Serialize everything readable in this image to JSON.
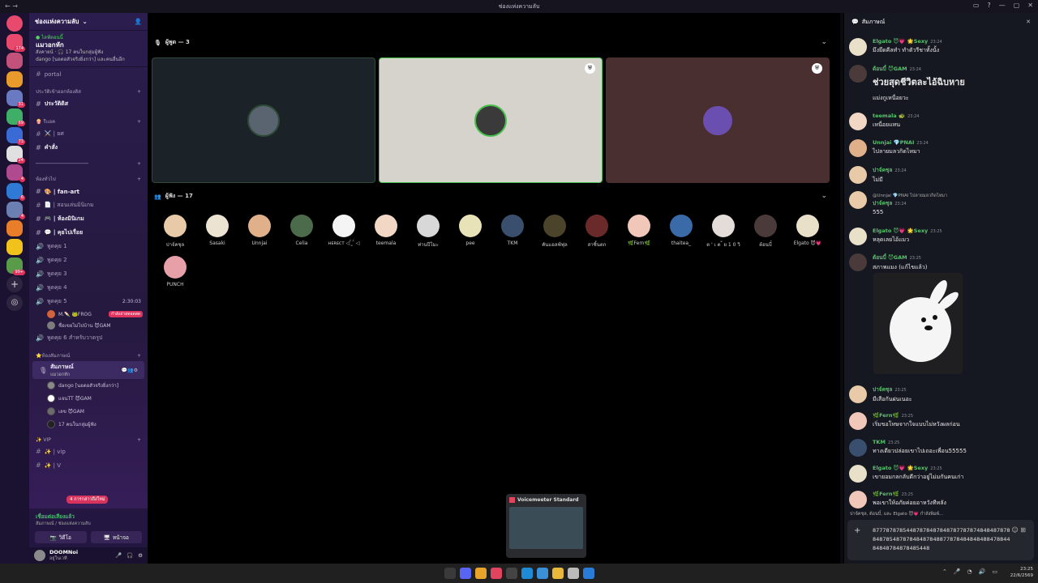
{
  "window": {
    "title": "ช่องแห่งความลับ"
  },
  "servers": [
    {
      "color": "#e84a6e",
      "badge": "174"
    },
    {
      "color": "#c2527a",
      "badge": ""
    },
    {
      "color": "#e89b2a",
      "badge": ""
    },
    {
      "color": "#6a7ac2",
      "badge": "31"
    },
    {
      "color": "#3fae67",
      "badge": "69"
    },
    {
      "color": "#3a6ad4",
      "badge": "73"
    },
    {
      "color": "#e0e0e0",
      "badge": "24"
    },
    {
      "color": "#b04a8e",
      "badge": "4"
    },
    {
      "color": "#2e7ad6",
      "badge": "6"
    },
    {
      "color": "#6b7fb3",
      "badge": "4"
    },
    {
      "color": "#e87e2a",
      "badge": ""
    },
    {
      "color": "#f2c21c",
      "badge": ""
    },
    {
      "color": "#5a9b4a",
      "badge": "99+"
    }
  ],
  "sidebar": {
    "server_name": "ช่องแห่งความลับ",
    "event": {
      "status": "● ไลฟ์ตอนนี้",
      "name": "แมวอกหัก",
      "line1": "สังคายน์ · 🎧 17 คนในกลุ่มผู้ฟัง",
      "line2": "dango [นอตอสัวจริงยิ่งกว่า] และคนอื่นอีก"
    },
    "portal": "portal",
    "categories": [
      {
        "name": "ประวัติเข้าออกห้องดิส",
        "channels": [
          {
            "label": "ประวัติดิส",
            "bold": true
          }
        ]
      },
      {
        "name": "🍿 รีแอค",
        "channels": [
          {
            "label": "⚔️ | ยศ",
            "bold": false
          },
          {
            "label": "คำสั่ง",
            "bold": true
          }
        ]
      },
      {
        "name": "──────────────────",
        "channels": []
      },
      {
        "name": "ห้องทั่วไป",
        "channels": [
          {
            "label": "🎨 | fan-art",
            "bold": true
          },
          {
            "label": "📄 | สอนเล่นมินิเกม",
            "bold": false
          },
          {
            "label": "🎮 | ห้องมินิเกม",
            "bold": true
          },
          {
            "label": "💬 | คุยไปเรื่อย",
            "bold": true
          }
        ]
      }
    ],
    "voice": [
      {
        "label": "พูดคุย 1"
      },
      {
        "label": "พูดคุย 2"
      },
      {
        "label": "พูดคุย 3"
      },
      {
        "label": "พูดคุย 4"
      },
      {
        "label": "พูดคุย 5",
        "time": "2:30:03"
      }
    ],
    "voice_users": [
      {
        "name": "M.🍡 🐸FROG",
        "color": "#d4633c",
        "live": "กำลังถ่ายทอดสด"
      },
      {
        "name": "ชื่อเขยไม่ไปบ้าน 😈GAM",
        "color": "#7d7d7d",
        "live": ""
      }
    ],
    "voice6": "พูดคุย 6 สำหรับวาดรูป",
    "stage_cat": "⭐ห้องสัมภาษณ์",
    "stage": {
      "label": "สัมภาษณ์",
      "sub": "แมวอกหัก"
    },
    "stage_users": [
      {
        "name": "dango [นอตอสัวจริงยิ่งกว่า]",
        "color": "#8a8a8a"
      },
      {
        "name": "แจนTT 😈GAM",
        "color": "#ffffff"
      },
      {
        "name": "เลข 😈GAM",
        "color": "#6b6b6b"
      },
      {
        "name": "17 คนในกลุ่มผู้ฟัง",
        "color": "#222"
      }
    ],
    "vip_cat": "✨ VIP",
    "vip_channels": [
      {
        "label": "✨ | vip"
      },
      {
        "label": "✨ | V"
      }
    ],
    "toast": "4 การกล่าวถึงใหม่",
    "connection": {
      "status": "เชื่อมต่อเสียงแล้ว",
      "sub": "สัมภาษณ์ / ช่องแห่งความลับ"
    },
    "video_btn": "วิดีโอ",
    "screen_btn": "หน้าจอ",
    "user": {
      "name": "DOOMNoi",
      "status": "อยู่ในเวที"
    }
  },
  "stage": {
    "speakers_label": "ผู้พูด — 3",
    "listeners_label": "ผู้ฟัง — 17",
    "speakers": [
      {
        "bg": "#1c2328",
        "avatar": "#5a6470",
        "border": "#2f4a38"
      },
      {
        "bg": "#d6d3cc",
        "avatar": "#3a3a3a",
        "border": "#46c04a",
        "pin": "⛨"
      },
      {
        "bg": "#4a2f31",
        "avatar": "#6b4fb0",
        "border": "#4a2f31",
        "pin": "⛨"
      }
    ],
    "listeners": [
      {
        "name": "ปาจ์คชุล",
        "color": "#e8c9a8"
      },
      {
        "name": "Sasaki",
        "color": "#ece3d2"
      },
      {
        "name": "Unnjai",
        "color": "#e0b08a"
      },
      {
        "name": "Celia",
        "color": "#4b6b4a"
      },
      {
        "name": "ʜᴇʀᴇᴄᴛ ◁ ̈́ ̫ ̈́ ◁",
        "color": "#f4f4f4"
      },
      {
        "name": "teemala",
        "color": "#f2d8c4"
      },
      {
        "name": "ท่านปีโมะ",
        "color": "#d8d8d8"
      },
      {
        "name": "pee",
        "color": "#e8e2b8"
      },
      {
        "name": "TKM",
        "color": "#3a4f6e"
      },
      {
        "name": "คันแอลฟ์ฟุล",
        "color": "#4b442a"
      },
      {
        "name": "สาซิ้นตก",
        "color": "#6b2a2a"
      },
      {
        "name": "🌿Fern🌿",
        "color": "#f0c7b8"
      },
      {
        "name": "thaitea_",
        "color": "#3a6aa8"
      },
      {
        "name": "ต ' เ ต ้ ย 1 0 วิ",
        "color": "#e4dcd8"
      },
      {
        "name": "ต้อนบี๋",
        "color": "#4a3a3a"
      },
      {
        "name": "Elgato 😈💗",
        "color": "#e8e0c8"
      },
      {
        "name": "PUNCH",
        "color": "#e8a0a8"
      }
    ],
    "popup_title": "Voicemeeter Standard"
  },
  "chat": {
    "title": "สัมภาษณ์",
    "messages": [
      {
        "name": "Elgato 😈💗 🌟Sexy",
        "time": "23:24",
        "text": "มึงยึดคีลทำ ทำตัวรีชาทั้งนั้ง",
        "color": "#57c46a",
        "av": "#e8e0c8"
      },
      {
        "name": "ต้อนบี๋ 😈GAM",
        "time": "23:24",
        "text": "ช่วยสุดชีวิตละไอ้ฉิบหาย",
        "color": "#57c46a",
        "av": "#4a3a3a",
        "big": true,
        "text2": "แม่งกูเหนื่อยวะ"
      },
      {
        "name": "teemala 🐢",
        "time": "23:24",
        "text": "เหนื่อยแทน",
        "color": "#57c46a",
        "av": "#f2d8c4"
      },
      {
        "name": "Unnjai 💎PNAI",
        "time": "23:24",
        "text": "ไปลายมลวกิดไหมา",
        "color": "#57c46a",
        "av": "#e0b08a"
      },
      {
        "name": "ปาจ์คชุล",
        "time": "23:24",
        "text": "ไม่มี",
        "color": "#57c46a",
        "av": "#e8c9a8"
      },
      {
        "name": "ปาจ์คชุล",
        "time": "23:24",
        "text": "555",
        "color": "#57c46a",
        "av": "#e8c9a8",
        "reply": "@Unnjai 💎PNAI ไปลายมลวกิดไหมา"
      },
      {
        "name": "Elgato 😈💗 🌟Sexy",
        "time": "23:25",
        "text": "หลุดเลยไอ้แมว",
        "color": "#57c46a",
        "av": "#e8e0c8"
      },
      {
        "name": "ต้อนบี๋ 😈GAM",
        "time": "23:25",
        "text": "สภาพแมง (แก้ไขแล้ว)",
        "color": "#57c46a",
        "av": "#4a3a3a"
      },
      {
        "name": "ปาจ์คชุล",
        "time": "23:25",
        "text": "มีเสือกันฝนเนอะ",
        "color": "#57c46a",
        "av": "#e8c9a8"
      },
      {
        "name": "🌿Fern🌿",
        "time": "23:25",
        "text": "เริ่มขอโทษจากใจแบบไม่หวังผลก่อน",
        "color": "#57c46a",
        "av": "#f0c7b8"
      },
      {
        "name": "TKM",
        "time": "23:25",
        "text": "ทางเดียวปล่อยเขาไปเถอะเพื่อน55555",
        "color": "#57c46a",
        "av": "#3a4f6e"
      },
      {
        "name": "Elgato 😈💗 🌟Sexy",
        "time": "23:25",
        "text": "เขายอมกลกลับดีกว่าอยู่ไม่มกันคนเก่า",
        "color": "#57c46a",
        "av": "#e8e0c8"
      },
      {
        "name": "🌿Fern🌿",
        "time": "23:25",
        "text": "พอเขาให้อภัยค่อยอาหวังทีหลัง",
        "color": "#57c46a",
        "av": "#f0c7b8"
      }
    ],
    "typing": "ปาจ์คชุล, ต้อนบี๋, และ Elgato 😈💗 กำลังพิมพ์...",
    "input_text": "877787878544878784878487877878748484878788487854878784848784887787848484848847884484848784878485448"
  },
  "taskbar": {
    "time": "23:25",
    "date": "22/6/2569"
  }
}
